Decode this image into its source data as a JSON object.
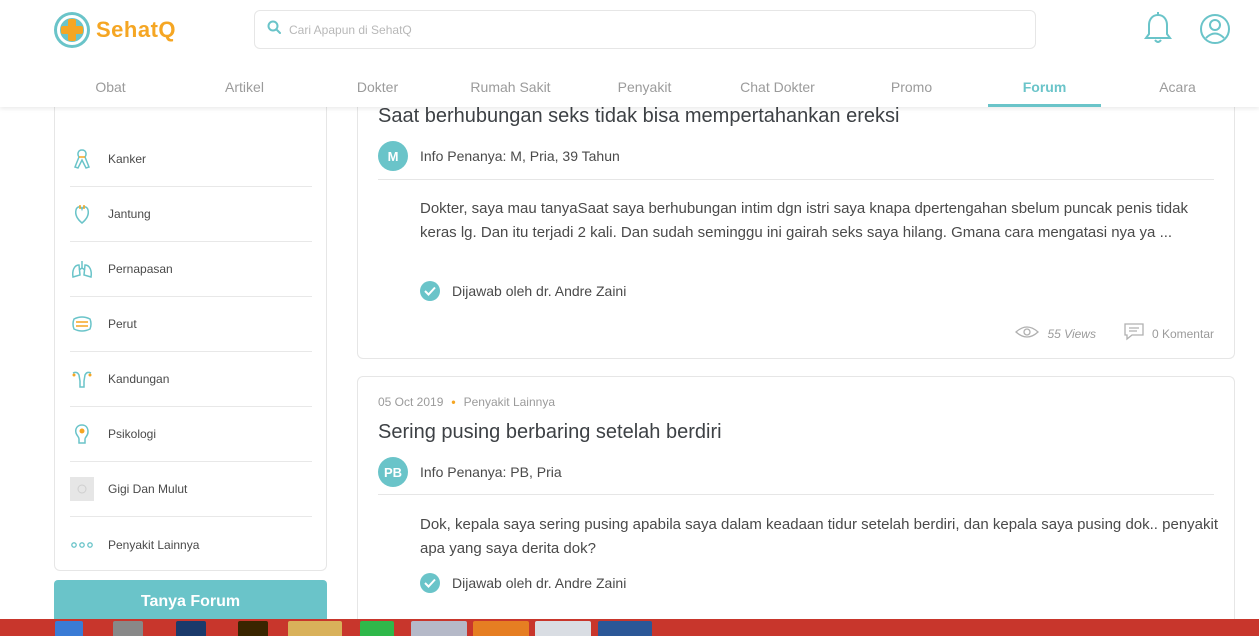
{
  "brand": {
    "name": "SehatQ",
    "accent": "#6ac4c9",
    "logo_orange": "#f5a623"
  },
  "search": {
    "placeholder": "Cari Apapun di SehatQ",
    "value": ""
  },
  "nav": {
    "items": [
      {
        "label": "Obat",
        "active": false
      },
      {
        "label": "Artikel",
        "active": false
      },
      {
        "label": "Dokter",
        "active": false
      },
      {
        "label": "Rumah Sakit",
        "active": false
      },
      {
        "label": "Penyakit",
        "active": false
      },
      {
        "label": "Chat Dokter",
        "active": false
      },
      {
        "label": "Promo",
        "active": false
      },
      {
        "label": "Forum",
        "active": true
      },
      {
        "label": "Acara",
        "active": false
      }
    ]
  },
  "sidebar": {
    "categories": [
      {
        "label": "Kanker",
        "icon": "ribbon-icon"
      },
      {
        "label": "Jantung",
        "icon": "heart-icon"
      },
      {
        "label": "Pernapasan",
        "icon": "lungs-icon"
      },
      {
        "label": "Perut",
        "icon": "stomach-icon"
      },
      {
        "label": "Kandungan",
        "icon": "uterus-icon"
      },
      {
        "label": "Psikologi",
        "icon": "head-icon"
      },
      {
        "label": "Gigi Dan Mulut",
        "icon": "tooth-icon"
      },
      {
        "label": "Penyakit Lainnya",
        "icon": "more-dots-icon"
      }
    ],
    "ask_button": "Tanya Forum"
  },
  "posts": [
    {
      "title": "Saat berhubungan seks tidak bisa mempertahankan ereksi",
      "avatar": "M",
      "asker_info": "Info Penanya: M, Pria, 39 Tahun",
      "body": "Dokter, saya mau tanyaSaat saya berhubungan intim dgn istri saya knapa dpertengahan sbelum puncak penis tidak keras lg. Dan itu terjadi 2 kali. Dan sudah seminggu ini gairah seks saya hilang. Gmana cara mengatasi nya ya ...",
      "answered_by": "Dijawab oleh dr. Andre Zaini",
      "views": "55 Views",
      "comments": "0 Komentar"
    },
    {
      "date": "05 Oct 2019",
      "category": "Penyakit Lainnya",
      "title": "Sering pusing berbaring setelah berdiri",
      "avatar": "PB",
      "asker_info": "Info Penanya: PB, Pria",
      "body": "Dok, kepala saya sering pusing apabila saya dalam keadaan tidur setelah berdiri, dan kepala saya pusing dok.. penyakit apa yang saya derita dok?",
      "answered_by": "Dijawab oleh dr. Andre Zaini"
    }
  ]
}
